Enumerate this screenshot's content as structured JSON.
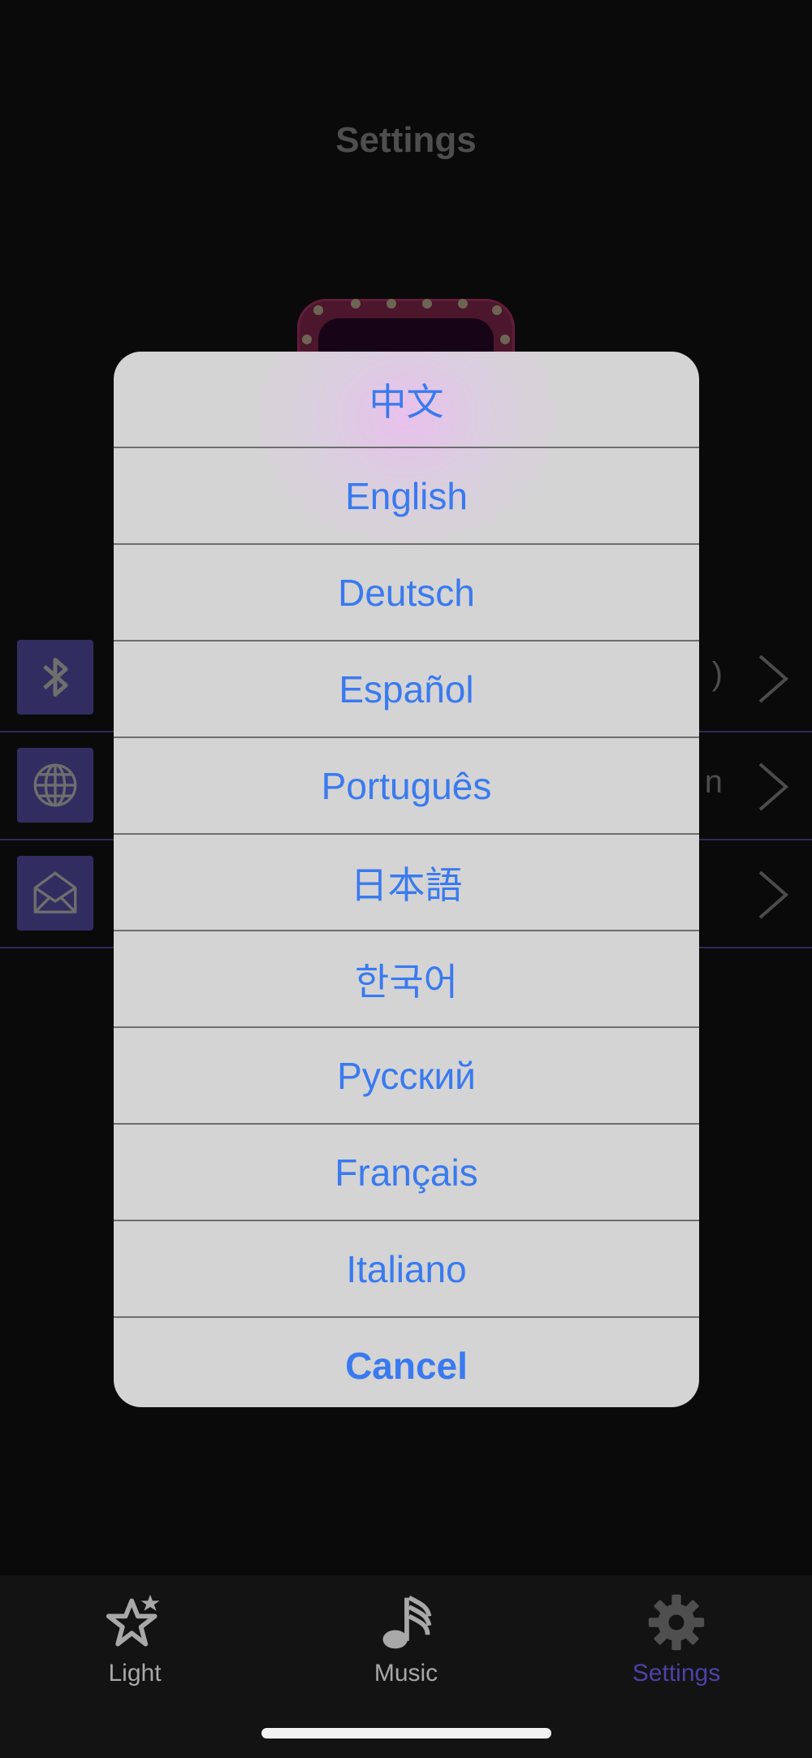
{
  "header": {
    "title": "Settings"
  },
  "rows": [
    {
      "label": "",
      "value": ")",
      "icon": "bluetooth-icon"
    },
    {
      "label": "",
      "value": "n",
      "icon": "globe-icon"
    },
    {
      "label": "",
      "value": "",
      "icon": "envelope-icon"
    }
  ],
  "language_sheet": {
    "options": [
      "中文",
      "English",
      "Deutsch",
      "Español",
      "Português",
      "日本語",
      "한국어",
      "Русский",
      "Français",
      "Italiano"
    ],
    "cancel": "Cancel"
  },
  "tabs": [
    {
      "label": "Light",
      "icon": "star-icon",
      "active": false
    },
    {
      "label": "Music",
      "icon": "music-note-icon",
      "active": false
    },
    {
      "label": "Settings",
      "icon": "gear-icon",
      "active": true
    }
  ],
  "colors": {
    "accent": "#5c52b0",
    "option_text": "#3a7af0",
    "background": "#131313"
  }
}
